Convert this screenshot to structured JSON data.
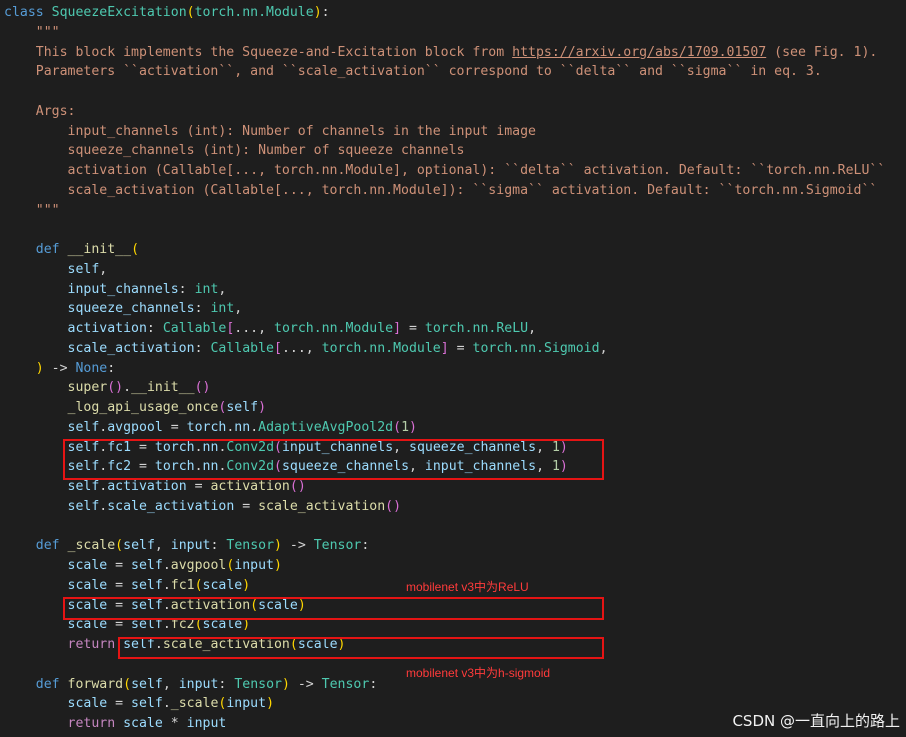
{
  "code_lines": [
    [
      [
        "kw",
        "class"
      ],
      [
        "p",
        " "
      ],
      [
        "cls",
        "SqueezeExcitation"
      ],
      [
        "paren",
        "("
      ],
      [
        "cls",
        "torch.nn.Module"
      ],
      [
        "paren",
        ")"
      ],
      [
        "p",
        ":"
      ]
    ],
    [
      [
        "doc",
        "    \"\"\""
      ]
    ],
    [
      [
        "doc",
        "    This block implements the Squeeze-and-Excitation block from "
      ],
      [
        "link",
        "https://arxiv.org/abs/1709.01507"
      ],
      [
        "doc",
        " (see Fig. 1)."
      ]
    ],
    [
      [
        "doc",
        "    Parameters ``activation``, and ``scale_activation`` correspond to ``delta`` and ``sigma`` in eq. 3."
      ]
    ],
    [
      [
        "doc",
        ""
      ]
    ],
    [
      [
        "doc",
        "    Args:"
      ]
    ],
    [
      [
        "doc",
        "        input_channels (int): Number of channels in the input image"
      ]
    ],
    [
      [
        "doc",
        "        squeeze_channels (int): Number of squeeze channels"
      ]
    ],
    [
      [
        "doc",
        "        activation (Callable[..., torch.nn.Module], optional): ``delta`` activation. Default: ``torch.nn.ReLU``"
      ]
    ],
    [
      [
        "doc",
        "        scale_activation (Callable[..., torch.nn.Module]): ``sigma`` activation. Default: ``torch.nn.Sigmoid``"
      ]
    ],
    [
      [
        "doc",
        "    \"\"\""
      ]
    ],
    [
      [
        "p",
        ""
      ]
    ],
    [
      [
        "kw",
        "    def"
      ],
      [
        "p",
        " "
      ],
      [
        "fn",
        "__init__"
      ],
      [
        "paren",
        "("
      ]
    ],
    [
      [
        "var",
        "        self"
      ],
      [
        "p",
        ","
      ]
    ],
    [
      [
        "var",
        "        input_channels"
      ],
      [
        "p",
        ": "
      ],
      [
        "cls",
        "int"
      ],
      [
        "p",
        ","
      ]
    ],
    [
      [
        "var",
        "        squeeze_channels"
      ],
      [
        "p",
        ": "
      ],
      [
        "cls",
        "int"
      ],
      [
        "p",
        ","
      ]
    ],
    [
      [
        "var",
        "        activation"
      ],
      [
        "p",
        ": "
      ],
      [
        "cls",
        "Callable"
      ],
      [
        "paren2",
        "["
      ],
      [
        "p",
        "..., "
      ],
      [
        "cls",
        "torch.nn.Module"
      ],
      [
        "paren2",
        "]"
      ],
      [
        "p",
        " = "
      ],
      [
        "cls",
        "torch.nn.ReLU"
      ],
      [
        "p",
        ","
      ]
    ],
    [
      [
        "var",
        "        scale_activation"
      ],
      [
        "p",
        ": "
      ],
      [
        "cls",
        "Callable"
      ],
      [
        "paren2",
        "["
      ],
      [
        "p",
        "..., "
      ],
      [
        "cls",
        "torch.nn.Module"
      ],
      [
        "paren2",
        "]"
      ],
      [
        "p",
        " = "
      ],
      [
        "cls",
        "torch.nn.Sigmoid"
      ],
      [
        "p",
        ","
      ]
    ],
    [
      [
        "paren",
        "    )"
      ],
      [
        "p",
        " -> "
      ],
      [
        "kw",
        "None"
      ],
      [
        "p",
        ":"
      ]
    ],
    [
      [
        "fn",
        "        super"
      ],
      [
        "paren2",
        "()"
      ],
      [
        "p",
        "."
      ],
      [
        "fn",
        "__init__"
      ],
      [
        "paren2",
        "()"
      ]
    ],
    [
      [
        "fn",
        "        _log_api_usage_once"
      ],
      [
        "paren2",
        "("
      ],
      [
        "var",
        "self"
      ],
      [
        "paren2",
        ")"
      ]
    ],
    [
      [
        "var",
        "        self"
      ],
      [
        "p",
        "."
      ],
      [
        "var",
        "avgpool"
      ],
      [
        "p",
        " = "
      ],
      [
        "var",
        "torch"
      ],
      [
        "p",
        "."
      ],
      [
        "var",
        "nn"
      ],
      [
        "p",
        "."
      ],
      [
        "cls",
        "AdaptiveAvgPool2d"
      ],
      [
        "paren2",
        "("
      ],
      [
        "num",
        "1"
      ],
      [
        "paren2",
        ")"
      ]
    ],
    [
      [
        "var",
        "        self"
      ],
      [
        "p",
        "."
      ],
      [
        "var",
        "fc1"
      ],
      [
        "p",
        " = "
      ],
      [
        "var",
        "torch"
      ],
      [
        "p",
        "."
      ],
      [
        "var",
        "nn"
      ],
      [
        "p",
        "."
      ],
      [
        "cls",
        "Conv2d"
      ],
      [
        "paren2",
        "("
      ],
      [
        "var",
        "input_channels"
      ],
      [
        "p",
        ", "
      ],
      [
        "var",
        "squeeze_channels"
      ],
      [
        "p",
        ", "
      ],
      [
        "num",
        "1"
      ],
      [
        "paren2",
        ")"
      ]
    ],
    [
      [
        "var",
        "        self"
      ],
      [
        "p",
        "."
      ],
      [
        "var",
        "fc2"
      ],
      [
        "p",
        " = "
      ],
      [
        "var",
        "torch"
      ],
      [
        "p",
        "."
      ],
      [
        "var",
        "nn"
      ],
      [
        "p",
        "."
      ],
      [
        "cls",
        "Conv2d"
      ],
      [
        "paren2",
        "("
      ],
      [
        "var",
        "squeeze_channels"
      ],
      [
        "p",
        ", "
      ],
      [
        "var",
        "input_channels"
      ],
      [
        "p",
        ", "
      ],
      [
        "num",
        "1"
      ],
      [
        "paren2",
        ")"
      ]
    ],
    [
      [
        "var",
        "        self"
      ],
      [
        "p",
        "."
      ],
      [
        "var",
        "activation"
      ],
      [
        "p",
        " = "
      ],
      [
        "fn",
        "activation"
      ],
      [
        "paren2",
        "()"
      ]
    ],
    [
      [
        "var",
        "        self"
      ],
      [
        "p",
        "."
      ],
      [
        "var",
        "scale_activation"
      ],
      [
        "p",
        " = "
      ],
      [
        "fn",
        "scale_activation"
      ],
      [
        "paren2",
        "()"
      ]
    ],
    [
      [
        "p",
        ""
      ]
    ],
    [
      [
        "kw",
        "    def"
      ],
      [
        "p",
        " "
      ],
      [
        "fn",
        "_scale"
      ],
      [
        "paren",
        "("
      ],
      [
        "var",
        "self"
      ],
      [
        "p",
        ", "
      ],
      [
        "var",
        "input"
      ],
      [
        "p",
        ": "
      ],
      [
        "cls",
        "Tensor"
      ],
      [
        "paren",
        ")"
      ],
      [
        "p",
        " -> "
      ],
      [
        "cls",
        "Tensor"
      ],
      [
        "p",
        ":"
      ]
    ],
    [
      [
        "var",
        "        scale"
      ],
      [
        "p",
        " = "
      ],
      [
        "var",
        "self"
      ],
      [
        "p",
        "."
      ],
      [
        "fn",
        "avgpool"
      ],
      [
        "paren",
        "("
      ],
      [
        "var",
        "input"
      ],
      [
        "paren",
        ")"
      ]
    ],
    [
      [
        "var",
        "        scale"
      ],
      [
        "p",
        " = "
      ],
      [
        "var",
        "self"
      ],
      [
        "p",
        "."
      ],
      [
        "fn",
        "fc1"
      ],
      [
        "paren",
        "("
      ],
      [
        "var",
        "scale"
      ],
      [
        "paren",
        ")"
      ]
    ],
    [
      [
        "var",
        "        scale"
      ],
      [
        "p",
        " = "
      ],
      [
        "var",
        "self"
      ],
      [
        "p",
        "."
      ],
      [
        "fn",
        "activation"
      ],
      [
        "paren",
        "("
      ],
      [
        "var",
        "scale"
      ],
      [
        "paren",
        ")"
      ]
    ],
    [
      [
        "var",
        "        scale"
      ],
      [
        "p",
        " = "
      ],
      [
        "var",
        "self"
      ],
      [
        "p",
        "."
      ],
      [
        "fn",
        "fc2"
      ],
      [
        "paren",
        "("
      ],
      [
        "var",
        "scale"
      ],
      [
        "paren",
        ")"
      ]
    ],
    [
      [
        "ctrl",
        "        return"
      ],
      [
        "p",
        " "
      ],
      [
        "var",
        "self"
      ],
      [
        "p",
        "."
      ],
      [
        "fn",
        "scale_activation"
      ],
      [
        "paren",
        "("
      ],
      [
        "var",
        "scale"
      ],
      [
        "paren",
        ")"
      ]
    ],
    [
      [
        "p",
        ""
      ]
    ],
    [
      [
        "kw",
        "    def"
      ],
      [
        "p",
        " "
      ],
      [
        "fn",
        "forward"
      ],
      [
        "paren",
        "("
      ],
      [
        "var",
        "self"
      ],
      [
        "p",
        ", "
      ],
      [
        "var",
        "input"
      ],
      [
        "p",
        ": "
      ],
      [
        "cls",
        "Tensor"
      ],
      [
        "paren",
        ")"
      ],
      [
        "p",
        " -> "
      ],
      [
        "cls",
        "Tensor"
      ],
      [
        "p",
        ":"
      ]
    ],
    [
      [
        "var",
        "        scale"
      ],
      [
        "p",
        " = "
      ],
      [
        "var",
        "self"
      ],
      [
        "p",
        "."
      ],
      [
        "fn",
        "_scale"
      ],
      [
        "paren",
        "("
      ],
      [
        "var",
        "input"
      ],
      [
        "paren",
        ")"
      ]
    ],
    [
      [
        "ctrl",
        "        return"
      ],
      [
        "p",
        " "
      ],
      [
        "var",
        "scale"
      ],
      [
        "p",
        " * "
      ],
      [
        "var",
        "input"
      ]
    ]
  ],
  "annotations": {
    "relu_note": "mobilenet v3中为ReLU",
    "hsigmoid_note": "mobilenet v3中为h-sigmoid"
  },
  "watermark": "CSDN @一直向上的路上"
}
